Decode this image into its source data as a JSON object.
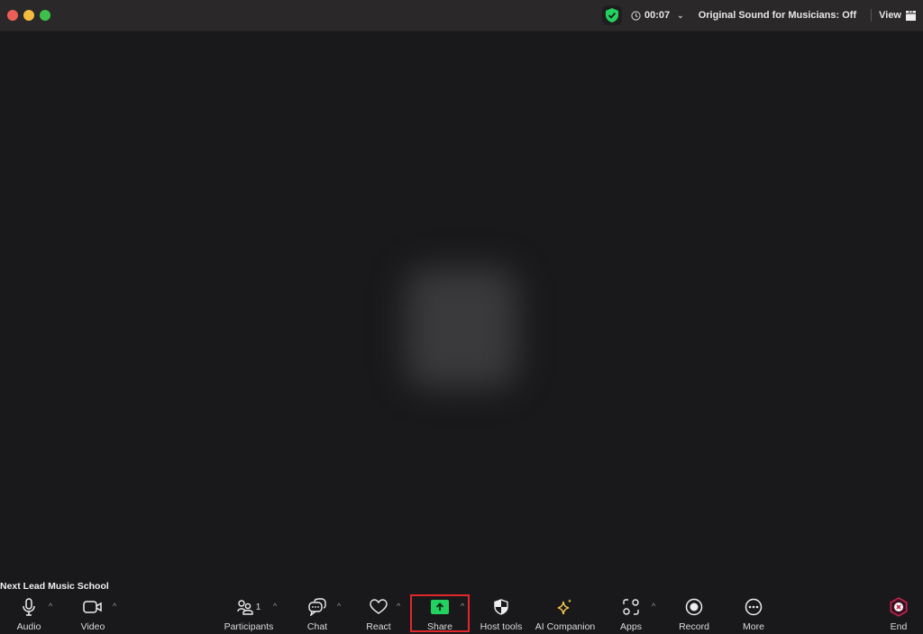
{
  "window": {
    "controls": [
      "close",
      "minimize",
      "maximize"
    ]
  },
  "topbar": {
    "security_icon": "shield-check-icon",
    "security_color": "#23d160",
    "timer": "00:07",
    "original_sound": "Original Sound for Musicians: Off",
    "view_label": "View"
  },
  "meeting": {
    "name": "Next Lead Music School"
  },
  "toolbar": {
    "audio": {
      "label": "Audio",
      "icon": "microphone-icon"
    },
    "video": {
      "label": "Video",
      "icon": "video-camera-icon"
    },
    "participants": {
      "label": "Participants",
      "icon": "participants-icon",
      "count": "1"
    },
    "chat": {
      "label": "Chat",
      "icon": "chat-icon"
    },
    "react": {
      "label": "React",
      "icon": "heart-icon"
    },
    "share": {
      "label": "Share",
      "icon": "share-screen-icon",
      "color": "#23d160",
      "highlight": "#e3262b"
    },
    "host_tools": {
      "label": "Host tools",
      "icon": "shield-icon"
    },
    "ai_companion": {
      "label": "AI Companion",
      "icon": "sparkle-icon",
      "color": "#f2c94c"
    },
    "apps": {
      "label": "Apps",
      "icon": "apps-icon"
    },
    "record": {
      "label": "Record",
      "icon": "record-icon"
    },
    "more": {
      "label": "More",
      "icon": "more-icon"
    },
    "end": {
      "label": "End",
      "icon": "end-icon",
      "color": "#c0244f"
    },
    "caret": "^"
  }
}
